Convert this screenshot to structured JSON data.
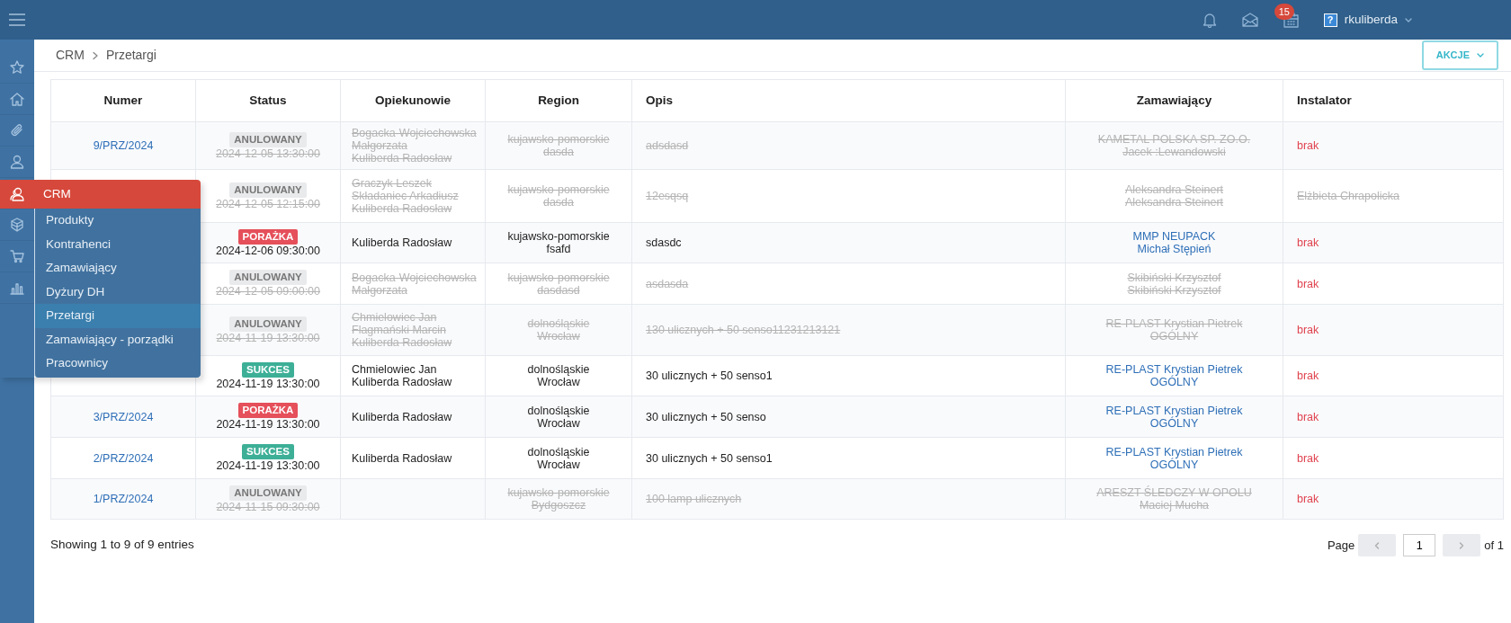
{
  "topbar": {
    "notifications_badge": "15",
    "user": "rkuliberda",
    "avatar": "?"
  },
  "breadcrumb": [
    "CRM",
    "Przetargi"
  ],
  "actions_button": "AKCJE",
  "flyout": {
    "title": "CRM",
    "items": [
      {
        "label": "Produkty",
        "selected": false
      },
      {
        "label": "Kontrahenci",
        "selected": false
      },
      {
        "label": "Zamawiający",
        "selected": false
      },
      {
        "label": "Dyżury DH",
        "selected": false
      },
      {
        "label": "Przetargi",
        "selected": true
      },
      {
        "label": "Zamawiający - porządki",
        "selected": false
      },
      {
        "label": "Pracownicy",
        "selected": false
      }
    ]
  },
  "table": {
    "columns": [
      "Numer",
      "Status",
      "Opiekunowie",
      "Region",
      "Opis",
      "Zamawiający",
      "Instalator"
    ],
    "rows": [
      {
        "cancelled": true,
        "numer": "9/PRZ/2024",
        "status": {
          "label": "ANULOWANY",
          "kind": "cancelled"
        },
        "date": "2024-12-05 13:30:00",
        "caretakers": [
          "Bogacka-Wojciechowska",
          "Małgorzata",
          "Kuliberda Radosław"
        ],
        "region": [
          "kujawsko-pomorskie",
          "dasda"
        ],
        "opis": "adsdasd",
        "client": [
          "KAMETAL POLSKA SP. ZO.O.",
          "Jacek :Lewandowski"
        ],
        "installer": {
          "text": "brak",
          "missing": true
        }
      },
      {
        "cancelled": true,
        "status": {
          "label": "ANULOWANY",
          "kind": "cancelled"
        },
        "date": "2024-12-05 12:15:00",
        "caretakers": [
          "Graczyk Leszek",
          "Składaniec Arkadiusz",
          "Kuliberda Radosław"
        ],
        "region": [
          "kujawsko-pomorskie",
          "dasda"
        ],
        "opis": "12esqsq",
        "client": [
          "Aleksandra Steinert",
          "Aleksandra Steinert"
        ],
        "installer": {
          "text": "Elżbieta Chrapolicka",
          "missing": false
        }
      },
      {
        "cancelled": false,
        "status": {
          "label": "PORAŻKA",
          "kind": "failure"
        },
        "date": "2024-12-06 09:30:00",
        "caretakers": [
          "Kuliberda Radosław"
        ],
        "region": [
          "kujawsko-pomorskie",
          "fsafd"
        ],
        "opis": "sdasdc",
        "client": [
          "MMP NEUPACK",
          "Michał Stępień"
        ],
        "installer": {
          "text": "brak",
          "missing": true
        }
      },
      {
        "cancelled": true,
        "status": {
          "label": "ANULOWANY",
          "kind": "cancelled"
        },
        "date": "2024-12-05 09:00:00",
        "caretakers": [
          "Bogacka-Wojciechowska",
          "Małgorzata"
        ],
        "region": [
          "kujawsko-pomorskie",
          "dasdasd"
        ],
        "opis": "asdasda",
        "client": [
          "Skibiński Krzysztof",
          "Skibiński Krzysztof"
        ],
        "installer": {
          "text": "brak",
          "missing": true
        }
      },
      {
        "cancelled": true,
        "status": {
          "label": "ANULOWANY",
          "kind": "cancelled"
        },
        "date": "2024-11-19 13:30:00",
        "caretakers": [
          "Chmielowiec Jan",
          "Flagmański Marcin",
          "Kuliberda Radosław"
        ],
        "region": [
          "dolnośląskie",
          "Wrocław"
        ],
        "opis": "130 ulicznych + 50 senso11231213121",
        "client": [
          "RE-PLAST Krystian Pietrek",
          "OGÓLNY"
        ],
        "installer": {
          "text": "brak",
          "missing": true
        }
      },
      {
        "cancelled": false,
        "status": {
          "label": "SUKCES",
          "kind": "success"
        },
        "date": "2024-11-19 13:30:00",
        "caretakers": [
          "Chmielowiec Jan",
          "Kuliberda Radosław"
        ],
        "region": [
          "dolnośląskie",
          "Wrocław"
        ],
        "opis": "30 ulicznych + 50 senso1",
        "client": [
          "RE-PLAST Krystian Pietrek",
          "OGÓLNY"
        ],
        "installer": {
          "text": "brak",
          "missing": true
        }
      },
      {
        "cancelled": false,
        "numer": "3/PRZ/2024",
        "status": {
          "label": "PORAŻKA",
          "kind": "failure"
        },
        "date": "2024-11-19 13:30:00",
        "caretakers": [
          "Kuliberda Radosław"
        ],
        "region": [
          "dolnośląskie",
          "Wrocław"
        ],
        "opis": "30 ulicznych + 50 senso",
        "client": [
          "RE-PLAST Krystian Pietrek",
          "OGÓLNY"
        ],
        "installer": {
          "text": "brak",
          "missing": true
        }
      },
      {
        "cancelled": false,
        "numer": "2/PRZ/2024",
        "status": {
          "label": "SUKCES",
          "kind": "success"
        },
        "date": "2024-11-19 13:30:00",
        "caretakers": [
          "Kuliberda Radosław"
        ],
        "region": [
          "dolnośląskie",
          "Wrocław"
        ],
        "opis": "30 ulicznych + 50 senso1",
        "client": [
          "RE-PLAST Krystian Pietrek",
          "OGÓLNY"
        ],
        "installer": {
          "text": "brak",
          "missing": true
        }
      },
      {
        "cancelled": true,
        "numer": "1/PRZ/2024",
        "status": {
          "label": "ANULOWANY",
          "kind": "cancelled"
        },
        "date": "2024-11-15 09:30:00",
        "region": [
          "kujawsko-pomorskie",
          "Bydgoszcz"
        ],
        "opis": "100 lamp ulicznych",
        "client": [
          "ARESZT ŚLEDCZY W OPOLU",
          "Maciej Mucha"
        ],
        "installer": {
          "text": "brak",
          "missing": true
        }
      }
    ]
  },
  "footer": {
    "info": "Showing 1 to 9 of 9 entries",
    "page_label": "Page",
    "page": "1",
    "of": "of 1"
  }
}
